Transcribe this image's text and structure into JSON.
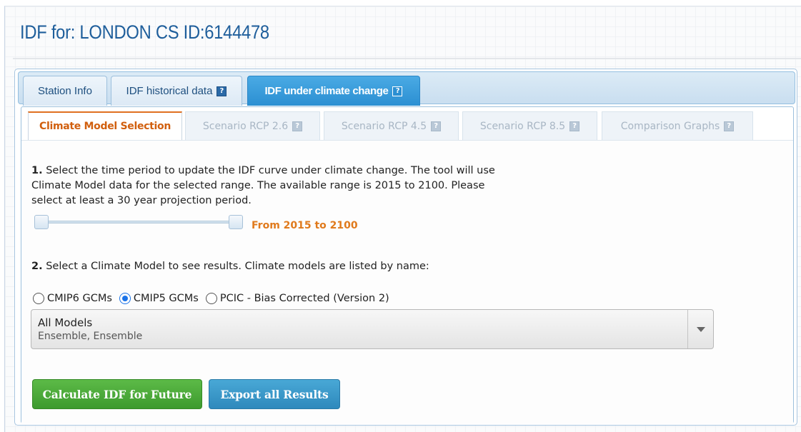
{
  "page": {
    "title": "IDF for: LONDON CS ID:6144478"
  },
  "outer_tabs": [
    {
      "label": "Station Info",
      "help": false,
      "active": false
    },
    {
      "label": "IDF historical data",
      "help": true,
      "active": false
    },
    {
      "label": "IDF under climate change",
      "help": true,
      "active": true
    }
  ],
  "inner_tabs": [
    {
      "label": "Climate Model Selection",
      "active": true
    },
    {
      "label": "Scenario RCP 2.6",
      "active": false
    },
    {
      "label": "Scenario RCP 4.5",
      "active": false
    },
    {
      "label": "Scenario RCP 8.5",
      "active": false
    },
    {
      "label": "Comparison Graphs",
      "active": false
    }
  ],
  "help_icon": "?",
  "step1": {
    "number": "1.",
    "text": "Select the time period to update the IDF curve under climate change. The tool will use Climate Model data for the selected range. The available range is 2015 to 2100. Please select at least a 30 year projection period."
  },
  "slider": {
    "value_label": "From 2015 to 2100",
    "start": 2015,
    "end": 2100
  },
  "step2": {
    "number": "2.",
    "text": "Select a Climate Model to see results. Climate models are listed by name:"
  },
  "radios": [
    {
      "label": "CMIP6 GCMs",
      "checked": false
    },
    {
      "label": "CMIP5 GCMs",
      "checked": true
    },
    {
      "label": "PCIC - Bias Corrected (Version 2)",
      "checked": false
    }
  ],
  "model_select": {
    "selected": "All Models",
    "subtext": "Ensemble, Ensemble"
  },
  "buttons": {
    "calculate": "Calculate IDF for Future",
    "export": "Export all Results"
  },
  "colors": {
    "title": "#1e5e9b",
    "active_tab": "#2b8fd2",
    "accent_orange": "#e07a1c",
    "green_button": "#3d9a2e",
    "blue_button": "#2e89bc"
  }
}
